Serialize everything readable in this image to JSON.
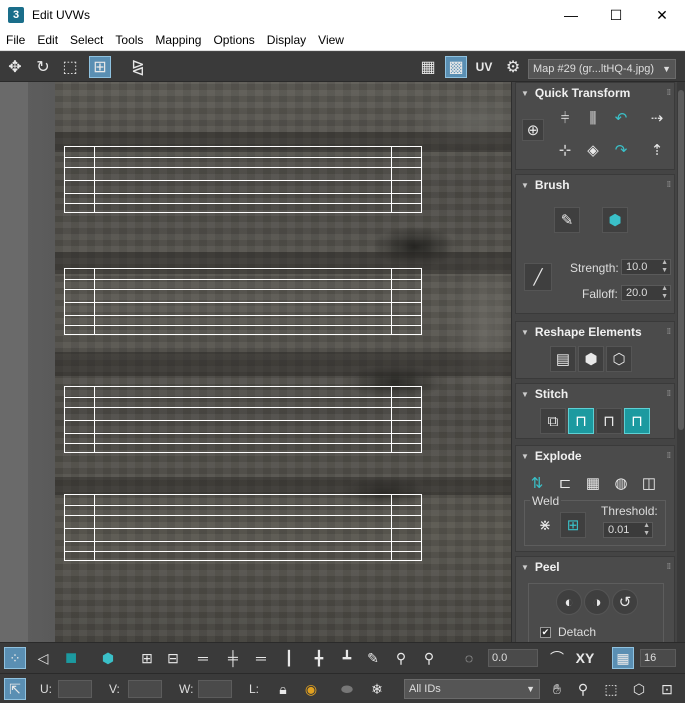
{
  "window": {
    "app_icon": "3",
    "title": "Edit UVWs",
    "minimize": "—",
    "maximize": "☐",
    "close": "✕"
  },
  "menu": [
    "File",
    "Edit",
    "Select",
    "Tools",
    "Mapping",
    "Options",
    "Display",
    "View"
  ],
  "toolbar": {
    "uv_label": "UV",
    "map_select": "Map #29 (gr...ltHQ-4.jpg)"
  },
  "panel": {
    "quick_transform": {
      "title": "Quick Transform"
    },
    "brush": {
      "title": "Brush",
      "strength_label": "Strength:",
      "strength_value": "10.0",
      "falloff_label": "Falloff:",
      "falloff_value": "20.0"
    },
    "reshape": {
      "title": "Reshape Elements"
    },
    "stitch": {
      "title": "Stitch"
    },
    "explode": {
      "title": "Explode",
      "weld_label": "Weld",
      "threshold_label": "Threshold:",
      "threshold_value": "0.01"
    },
    "peel": {
      "title": "Peel",
      "detach_label": "Detach",
      "detach_checked": true
    }
  },
  "bottom_bar": {
    "rotation_value": "0.0",
    "xy_label": "XY",
    "grid_value": "16",
    "u_label": "U:",
    "u_value": "",
    "v_label": "V:",
    "v_value": "",
    "w_label": "W:",
    "w_value": "",
    "l_label": "L:",
    "ids_select": "All IDs"
  },
  "colors": {
    "accent": "#1c9aa0",
    "active_tool": "#5a8fb3",
    "uv_wire": "#ffffff"
  }
}
